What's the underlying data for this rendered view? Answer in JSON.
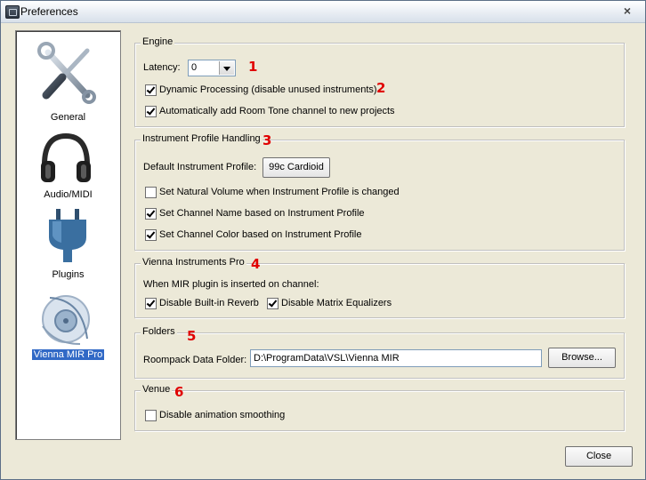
{
  "window": {
    "title": "Preferences",
    "close_glyph": "×"
  },
  "sidebar": {
    "items": [
      {
        "label": "General",
        "icon": "tools-icon"
      },
      {
        "label": "Audio/MIDI",
        "icon": "headphones-icon"
      },
      {
        "label": "Plugins",
        "icon": "plug-icon"
      },
      {
        "label": "Vienna MIR Pro",
        "icon": "mir-icon",
        "selected": true
      }
    ]
  },
  "engine": {
    "title": "Engine",
    "latency_label": "Latency:",
    "latency_value": "0",
    "dynamic_processing": {
      "label": "Dynamic Processing (disable unused instruments)",
      "checked": true
    },
    "room_tone": {
      "label": "Automatically add Room Tone channel to new projects",
      "checked": true
    },
    "marker": "1",
    "marker2": "2"
  },
  "profile": {
    "title": "Instrument Profile Handling",
    "marker": "3",
    "default_label": "Default Instrument Profile:",
    "default_button": "99c Cardioid",
    "natural_volume": {
      "label": "Set Natural Volume when Instrument Profile is changed",
      "checked": false
    },
    "channel_name": {
      "label": "Set Channel Name based on Instrument Profile",
      "checked": true
    },
    "channel_color": {
      "label": "Set Channel Color based on Instrument Profile",
      "checked": true
    }
  },
  "vip": {
    "title": "Vienna Instruments Pro",
    "marker": "4",
    "intro": "When MIR plugin is inserted on channel:",
    "reverb": {
      "label": "Disable Built-in Reverb",
      "checked": true
    },
    "eq": {
      "label": "Disable Matrix Equalizers",
      "checked": true
    }
  },
  "folders": {
    "title": "Folders",
    "marker": "5",
    "roompack_label": "Roompack Data Folder:",
    "roompack_value": "D:\\ProgramData\\VSL\\Vienna MIR",
    "browse": "Browse..."
  },
  "venue": {
    "title": "Venue",
    "marker": "6",
    "anim": {
      "label": "Disable animation smoothing",
      "checked": false
    }
  },
  "footer": {
    "close": "Close"
  },
  "colors": {
    "marker": "#e00000",
    "selection": "#3169c6"
  }
}
